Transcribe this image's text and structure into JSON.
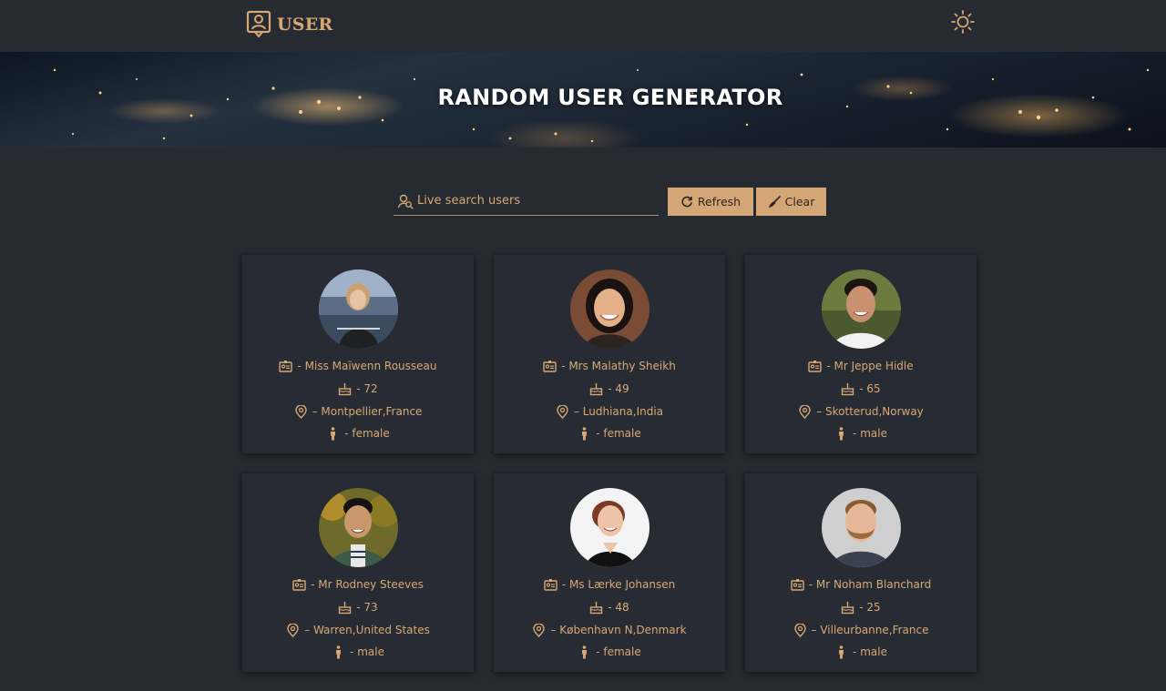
{
  "app": {
    "brand": "USER"
  },
  "hero": {
    "title": "RANDOM USER GENERATOR"
  },
  "toolbar": {
    "search_placeholder": "Live search users",
    "refresh_label": "Refresh",
    "clear_label": "Clear"
  },
  "colors": {
    "background": "#262a31",
    "accent": "#d9a872",
    "button_bg": "#d5a675"
  },
  "users": [
    {
      "name": "- Miss Maïwenn Rousseau",
      "age": "- 72",
      "location": "– Montpellier,France",
      "gender": "- female"
    },
    {
      "name": "- Mrs Malathy Sheikh",
      "age": "- 49",
      "location": "– Ludhiana,India",
      "gender": "- female"
    },
    {
      "name": "- Mr Jeppe Hidle",
      "age": "- 65",
      "location": "– Skotterud,Norway",
      "gender": "- male"
    },
    {
      "name": "- Mr Rodney Steeves",
      "age": "- 73",
      "location": "– Warren,United States",
      "gender": "- male"
    },
    {
      "name": "- Ms Lærke Johansen",
      "age": "- 48",
      "location": "– København N,Denmark",
      "gender": "- female"
    },
    {
      "name": "- Mr Noham Blanchard",
      "age": "- 25",
      "location": "– Villeurbanne,France",
      "gender": "- male"
    }
  ]
}
